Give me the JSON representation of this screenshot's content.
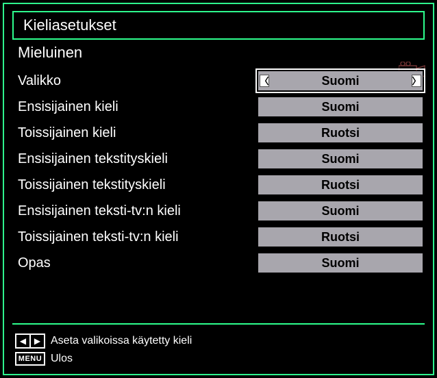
{
  "title": "Kieliasetukset",
  "section": "Mieluinen",
  "rows": [
    {
      "label": "Valikko",
      "value": "Suomi",
      "selected": true
    },
    {
      "label": "Ensisijainen kieli",
      "value": "Suomi",
      "selected": false
    },
    {
      "label": "Toissijainen kieli",
      "value": "Ruotsi",
      "selected": false
    },
    {
      "label": "Ensisijainen tekstityskieli",
      "value": "Suomi",
      "selected": false
    },
    {
      "label": "Toissijainen tekstityskieli",
      "value": "Ruotsi",
      "selected": false
    },
    {
      "label": "Ensisijainen teksti-tv:n kieli",
      "value": "Suomi",
      "selected": false
    },
    {
      "label": "Toissijainen teksti-tv:n kieli",
      "value": "Ruotsi",
      "selected": false
    },
    {
      "label": "Opas",
      "value": "Suomi",
      "selected": false
    }
  ],
  "footer": {
    "hint": "Aseta valikoissa käytetty kieli",
    "menu_label": "MENU",
    "menu_action": "Ulos"
  }
}
